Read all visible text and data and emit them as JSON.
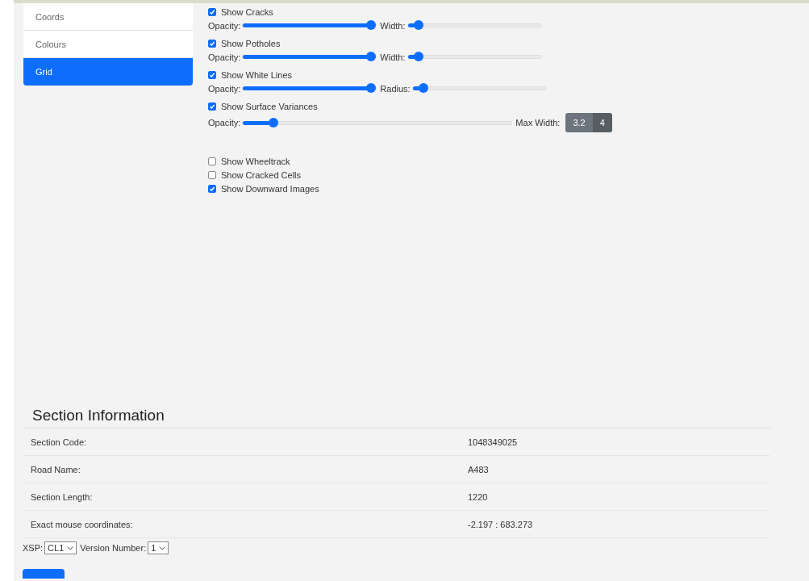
{
  "sidebar": {
    "items": [
      {
        "label": "Coords",
        "selected": false
      },
      {
        "label": "Colours",
        "selected": false
      },
      {
        "label": "Grid",
        "selected": true
      }
    ]
  },
  "layers": [
    {
      "label": "Show Cracks",
      "checked": true,
      "sliders": [
        {
          "label": "Opacity:",
          "level": 1.0
        },
        {
          "label": "Width:",
          "level": 0.05
        }
      ]
    },
    {
      "label": "Show Potholes",
      "checked": true,
      "sliders": [
        {
          "label": "Opacity:",
          "level": 1.0
        },
        {
          "label": "Width:",
          "level": 0.05
        }
      ]
    },
    {
      "label": "Show White Lines",
      "checked": true,
      "sliders": [
        {
          "label": "Opacity:",
          "level": 1.0
        },
        {
          "label": "Radius:",
          "level": 0.05
        }
      ]
    },
    {
      "label": "Show Surface Variances",
      "checked": true,
      "sliders": [
        {
          "label": "Opacity:",
          "level": 0.1
        }
      ],
      "max_width": {
        "label": "Max Width:",
        "options": [
          {
            "label": "3.2",
            "selected": false
          },
          {
            "label": "4",
            "selected": true
          }
        ]
      }
    }
  ],
  "toggles": [
    {
      "label": "Show Wheeltrack",
      "checked": false
    },
    {
      "label": "Show Cracked Cells",
      "checked": false
    },
    {
      "label": "Show Downward Images",
      "checked": true
    }
  ],
  "section_info": {
    "title": "Section Information",
    "rows": [
      {
        "label": "Section Code:",
        "value": "1048349025"
      },
      {
        "label": "Road Name:",
        "value": "A483"
      },
      {
        "label": "Section Length:",
        "value": "1220"
      },
      {
        "label": "Exact mouse coordinates:",
        "value": "-2.197 : 683.273"
      }
    ]
  },
  "selectors": [
    {
      "label": "XSP:",
      "value": "CL1"
    },
    {
      "label": "Version Number:",
      "value": "1"
    }
  ]
}
